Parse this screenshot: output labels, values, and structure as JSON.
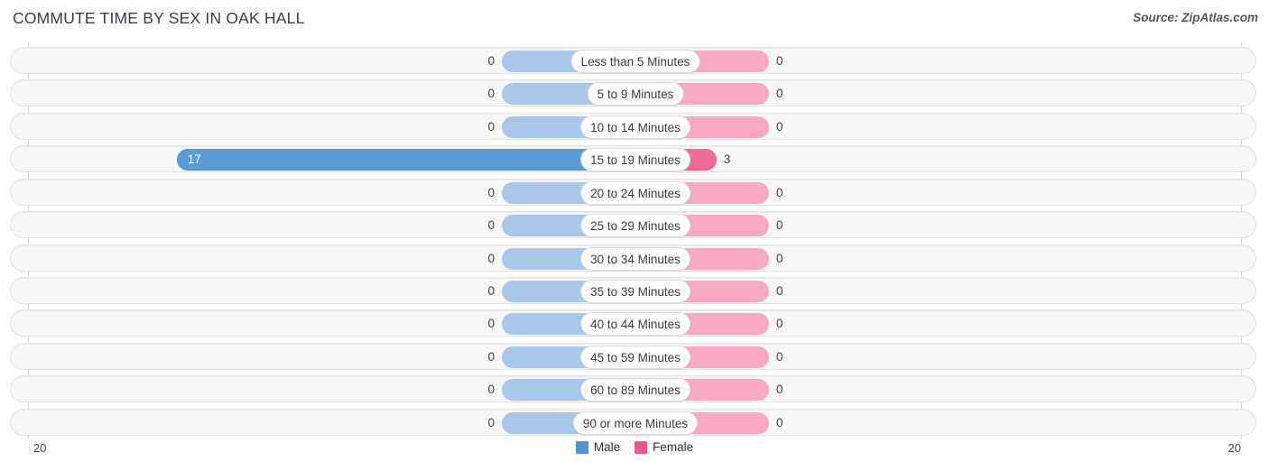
{
  "header": {
    "title": "COMMUTE TIME BY SEX IN OAK HALL",
    "source": "Source: ZipAtlas.com"
  },
  "axis": {
    "left_tick": "20",
    "right_tick": "20"
  },
  "legend": {
    "items": [
      {
        "label": "Male",
        "color": "#5291d4",
        "icon": "square-swatch-icon"
      },
      {
        "label": "Female",
        "color": "#f2558b",
        "icon": "square-swatch-icon"
      }
    ]
  },
  "chart_data": {
    "type": "bar",
    "orientation": "horizontal-diverging",
    "title": "COMMUTE TIME BY SEX IN OAK HALL",
    "xlabel": "",
    "ylabel": "",
    "xlim": [
      -20,
      20
    ],
    "axis_max": 20,
    "grid": false,
    "legend_position": "bottom-center",
    "categories": [
      "Less than 5 Minutes",
      "5 to 9 Minutes",
      "10 to 14 Minutes",
      "15 to 19 Minutes",
      "20 to 24 Minutes",
      "25 to 29 Minutes",
      "30 to 34 Minutes",
      "35 to 39 Minutes",
      "40 to 44 Minutes",
      "45 to 59 Minutes",
      "60 to 89 Minutes",
      "90 or more Minutes"
    ],
    "series": [
      {
        "name": "Male",
        "color": "#5b9bd8",
        "zero_color": "#a8c8ea",
        "values": [
          0,
          0,
          0,
          17,
          0,
          0,
          0,
          0,
          0,
          0,
          0,
          0
        ],
        "labels": [
          "0",
          "0",
          "0",
          "17",
          "0",
          "0",
          "0",
          "0",
          "0",
          "0",
          "0",
          "0"
        ]
      },
      {
        "name": "Female",
        "color": "#f4699a",
        "zero_color": "#f9a8c4",
        "values": [
          0,
          0,
          0,
          3,
          0,
          0,
          0,
          0,
          0,
          0,
          0,
          0
        ],
        "labels": [
          "0",
          "0",
          "0",
          "3",
          "0",
          "0",
          "0",
          "0",
          "0",
          "0",
          "0",
          "0"
        ]
      }
    ]
  }
}
